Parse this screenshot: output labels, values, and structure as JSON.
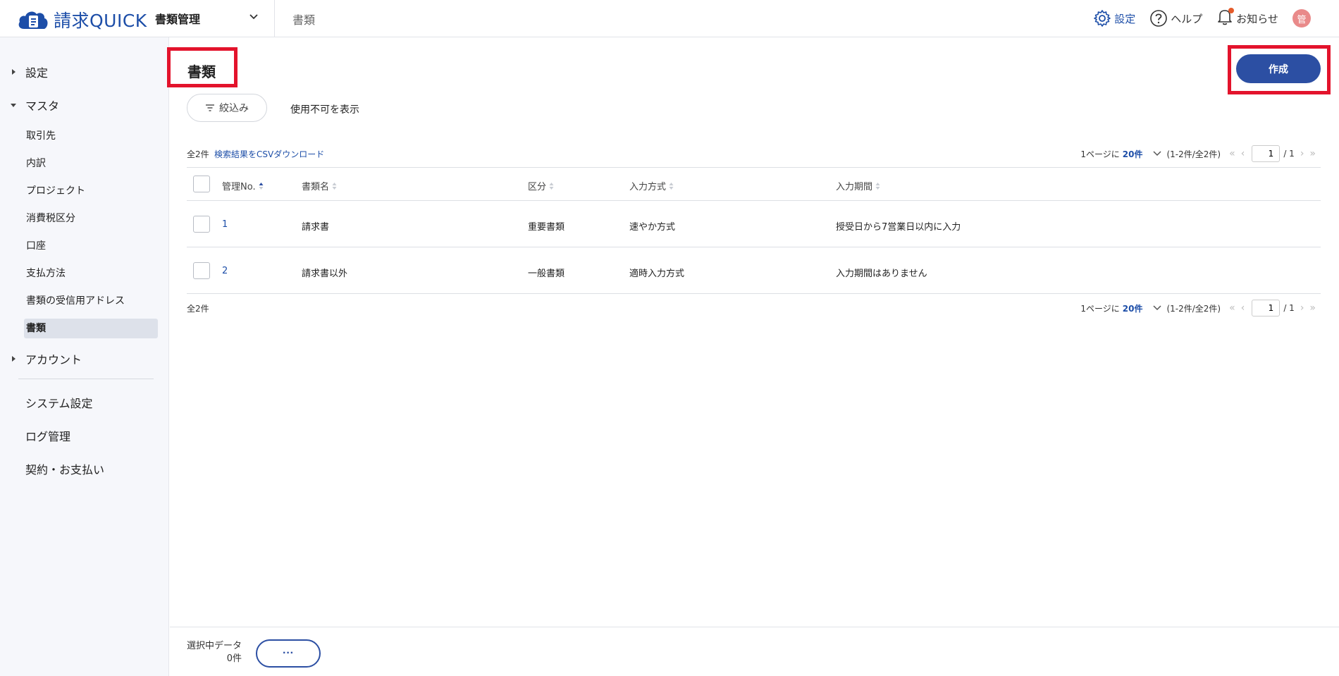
{
  "header": {
    "logo_text": "請求QUICK",
    "app_selector": "書類管理",
    "breadcrumb": "書類",
    "settings_label": "設定",
    "help_label": "ヘルプ",
    "notifications_label": "お知らせ",
    "avatar_initial": "管"
  },
  "sidebar": {
    "groups": {
      "settings": "設定",
      "master": "マスタ",
      "account": "アカウント"
    },
    "master_items": [
      "取引先",
      "内訳",
      "プロジェクト",
      "消費税区分",
      "口座",
      "支払方法",
      "書類の受信用アドレス",
      "書類"
    ],
    "active_item": "書類",
    "lower_items": [
      "システム設定",
      "ログ管理",
      "契約・お支払い"
    ]
  },
  "main": {
    "title": "書類",
    "create_label": "作成",
    "filter_label": "絞込み",
    "show_disabled_label": "使用不可を表示",
    "count_label": "全2件",
    "csv_link": "検索結果をCSVダウンロード",
    "pager": {
      "per_page_prefix": "1ページに",
      "per_page_value": "20件",
      "range": "(1-2件/全2件)",
      "current_page": "1",
      "total_pages": "/ 1"
    },
    "columns": [
      "管理No.",
      "書類名",
      "区分",
      "入力方式",
      "入力期間"
    ],
    "rows": [
      {
        "no": "1",
        "name": "請求書",
        "category": "重要書類",
        "input_method": "速やか方式",
        "period": "授受日から7営業日以内に入力"
      },
      {
        "no": "2",
        "name": "請求書以外",
        "category": "一般書類",
        "input_method": "適時入力方式",
        "period": "入力期間はありません"
      }
    ]
  },
  "bottom": {
    "selected_label": "選択中データ",
    "selected_count": "0件",
    "more_label": "···"
  },
  "colors": {
    "brand": "#1d4ea8",
    "primary_button": "#2c4fa3",
    "highlight": "#e3132c"
  }
}
